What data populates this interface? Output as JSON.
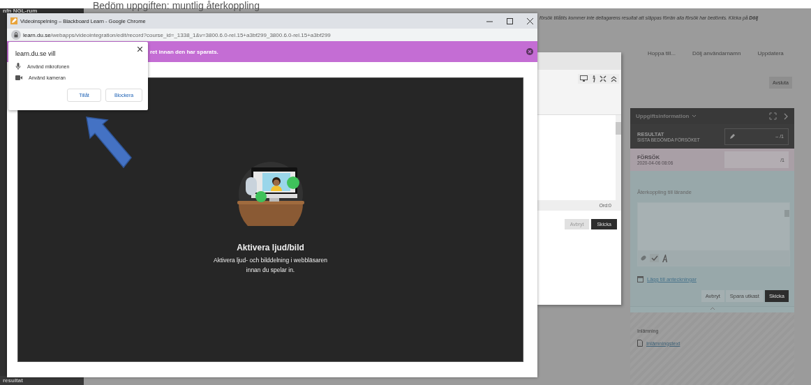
{
  "background_page": {
    "heading": "Bedöm uppgiften: muntlig återkoppling",
    "course": "nfn NGL-rum",
    "sidebar_bottom": "resultat",
    "notice": "försök tillåtits kommer inte deltagarens resultat att släppas förrän alla försök har bedömts. Klicka på **Dölj**",
    "nav_links": [
      "Hoppa till...",
      "Dölj användarnamn",
      "Uppdatera"
    ],
    "finish_button": "Avsluta"
  },
  "grading_panel": {
    "header": "Uppgiftsinformation",
    "result_label": "RESULTAT",
    "result_sub": "SISTA BEDÖMDA FÖRSÖKET",
    "result_value": "–",
    "result_max": "/1",
    "attempt_label": "FÖRSÖK",
    "attempt_date": "2020-04-06 08:06",
    "attempt_max": "/1",
    "feedback_label": "Återkoppling till lärande",
    "notes_link": "Lägg till anteckningar",
    "buttons": [
      {
        "label": "Avbryt",
        "primary": false
      },
      {
        "label": "Spara utkast",
        "primary": false
      },
      {
        "label": "Skicka",
        "primary": true
      }
    ],
    "submission_label": "Inlämning",
    "submission_link": "Inlämningstext"
  },
  "editor_dialog": {
    "word_count": "Ord:0",
    "buttons": [
      {
        "label": "Avbryt",
        "primary": false
      },
      {
        "label": "Skicka",
        "primary": true
      }
    ]
  },
  "popup_window": {
    "title": "Videoinspelning – Blackboard Learn - Google Chrome",
    "url_host": "learn.du.se",
    "url_path": "/webapps/videointegration/edit/record?course_id=_1338_1&v=3800.6.0-rel.15+a3bf299_3800.6.0-rel.15+a3bf299",
    "banner": "ret innan den har sparats.",
    "heading": "Aktivera ljud/bild",
    "message": "Aktivera ljud- och bilddelning i webbläsaren innan du spelar in."
  },
  "permission_prompt": {
    "title": "learn.du.se vill",
    "items": [
      {
        "kind": "microphone",
        "label": "Använd mikrofonen"
      },
      {
        "kind": "camera",
        "label": "Använd kameran"
      }
    ],
    "buttons": [
      "Tillåt",
      "Blockera"
    ]
  }
}
